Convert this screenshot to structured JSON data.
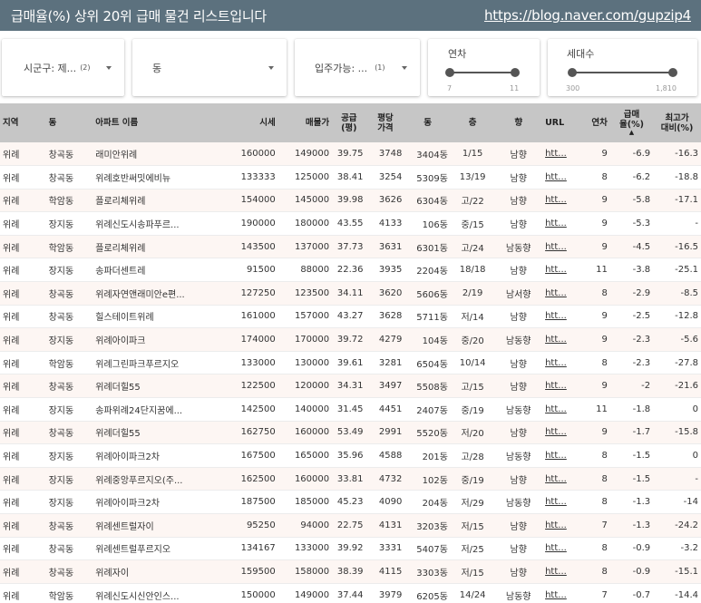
{
  "header": {
    "title": "급매율(%) 상위 20위 급매 물건 리스트입니다",
    "link": "https://blog.naver.com/gupzip4"
  },
  "filters": {
    "sigungu": {
      "label": "시군구: 제...",
      "count": "(2)"
    },
    "dong": {
      "label": "동",
      "count": ""
    },
    "move_in": {
      "label": "입주가능: ...",
      "count": "(1)"
    },
    "year": {
      "label": "연차",
      "min_label": "7",
      "max_label": "11",
      "range_low": 0,
      "range_high": 1
    },
    "households": {
      "label": "세대수",
      "min_label": "300",
      "max_label": "1,810",
      "range_low": 0,
      "range_high": 1
    }
  },
  "table": {
    "columns": [
      "지역",
      "동",
      "아파트 이름",
      "시세",
      "매물가",
      "공급\n(평)",
      "평당\n가격",
      "동",
      "층",
      "향",
      "URL",
      "연차",
      "급매\n율(%)",
      "최고가\n대비(%)"
    ],
    "rows": [
      [
        "위례",
        "창곡동",
        "래미안위례",
        "160000",
        "149000",
        "39.75",
        "3748",
        "3404동",
        "1/15",
        "남향",
        "htt...",
        "9",
        "-6.9",
        "-16.3"
      ],
      [
        "위례",
        "창곡동",
        "위례호반써밋에비뉴",
        "133333",
        "125000",
        "38.41",
        "3254",
        "5309동",
        "13/19",
        "남향",
        "htt...",
        "8",
        "-6.2",
        "-18.8"
      ],
      [
        "위례",
        "학암동",
        "플로리체위례",
        "154000",
        "145000",
        "39.98",
        "3626",
        "6304동",
        "고/22",
        "남향",
        "htt...",
        "9",
        "-5.8",
        "-17.1"
      ],
      [
        "위례",
        "장지동",
        "위례신도시송파푸르...",
        "190000",
        "180000",
        "43.55",
        "4133",
        "106동",
        "중/15",
        "남향",
        "htt...",
        "9",
        "-5.3",
        "-"
      ],
      [
        "위례",
        "학암동",
        "플로리체위례",
        "143500",
        "137000",
        "37.73",
        "3631",
        "6301동",
        "고/24",
        "남동향",
        "htt...",
        "9",
        "-4.5",
        "-16.5"
      ],
      [
        "위례",
        "장지동",
        "송파더센트레",
        "91500",
        "88000",
        "22.36",
        "3935",
        "2204동",
        "18/18",
        "남향",
        "htt...",
        "11",
        "-3.8",
        "-25.1"
      ],
      [
        "위례",
        "창곡동",
        "위례자연앤래미안e편...",
        "127250",
        "123500",
        "34.11",
        "3620",
        "5606동",
        "2/19",
        "남서향",
        "htt...",
        "8",
        "-2.9",
        "-8.5"
      ],
      [
        "위례",
        "창곡동",
        "힐스테이트위례",
        "161000",
        "157000",
        "43.27",
        "3628",
        "5711동",
        "저/14",
        "남향",
        "htt...",
        "9",
        "-2.5",
        "-12.8"
      ],
      [
        "위례",
        "장지동",
        "위례아이파크",
        "174000",
        "170000",
        "39.72",
        "4279",
        "104동",
        "중/20",
        "남동향",
        "htt...",
        "9",
        "-2.3",
        "-5.6"
      ],
      [
        "위례",
        "학암동",
        "위례그린파크푸르지오",
        "133000",
        "130000",
        "39.61",
        "3281",
        "6504동",
        "10/14",
        "남향",
        "htt...",
        "8",
        "-2.3",
        "-27.8"
      ],
      [
        "위례",
        "창곡동",
        "위례더힐55",
        "122500",
        "120000",
        "34.31",
        "3497",
        "5508동",
        "고/15",
        "남향",
        "htt...",
        "9",
        "-2",
        "-21.6"
      ],
      [
        "위례",
        "장지동",
        "송파위례24단지꿈에...",
        "142500",
        "140000",
        "31.45",
        "4451",
        "2407동",
        "중/19",
        "남동향",
        "htt...",
        "11",
        "-1.8",
        "0"
      ],
      [
        "위례",
        "창곡동",
        "위례더힐55",
        "162750",
        "160000",
        "53.49",
        "2991",
        "5520동",
        "저/20",
        "남향",
        "htt...",
        "9",
        "-1.7",
        "-15.8"
      ],
      [
        "위례",
        "장지동",
        "위례아이파크2차",
        "167500",
        "165000",
        "35.96",
        "4588",
        "201동",
        "고/28",
        "남동향",
        "htt...",
        "8",
        "-1.5",
        "0"
      ],
      [
        "위례",
        "장지동",
        "위례중앙푸르지오(주...",
        "162500",
        "160000",
        "33.81",
        "4732",
        "102동",
        "중/19",
        "남향",
        "htt...",
        "8",
        "-1.5",
        "-"
      ],
      [
        "위례",
        "장지동",
        "위례아이파크2차",
        "187500",
        "185000",
        "45.23",
        "4090",
        "204동",
        "저/29",
        "남동향",
        "htt...",
        "8",
        "-1.3",
        "-14"
      ],
      [
        "위례",
        "창곡동",
        "위례센트럴자이",
        "95250",
        "94000",
        "22.75",
        "4131",
        "3203동",
        "저/15",
        "남향",
        "htt...",
        "7",
        "-1.3",
        "-24.2"
      ],
      [
        "위례",
        "창곡동",
        "위례센트럴푸르지오",
        "134167",
        "133000",
        "39.92",
        "3331",
        "5407동",
        "저/25",
        "남향",
        "htt...",
        "8",
        "-0.9",
        "-3.2"
      ],
      [
        "위례",
        "창곡동",
        "위례자이",
        "159500",
        "158000",
        "38.39",
        "4115",
        "3303동",
        "저/15",
        "남향",
        "htt...",
        "8",
        "-0.9",
        "-15.1"
      ],
      [
        "위례",
        "학암동",
        "위례신도시신안인스...",
        "150000",
        "149000",
        "37.44",
        "3979",
        "6205동",
        "14/24",
        "남동향",
        "htt...",
        "7",
        "-0.7",
        "-14.4"
      ]
    ]
  }
}
